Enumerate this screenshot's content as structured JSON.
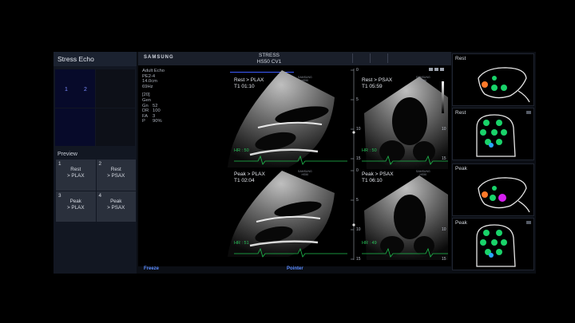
{
  "left_panel": {
    "title": "Stress Echo",
    "layout_cells": [
      "1",
      "2",
      "3",
      "4"
    ],
    "preview_label": "Preview",
    "preview_items": [
      {
        "num": "1",
        "line1": "Rest",
        "line2": "> PLAX"
      },
      {
        "num": "2",
        "line1": "Rest",
        "line2": "> PSAX"
      },
      {
        "num": "3",
        "line1": "Peak",
        "line2": "> PLAX"
      },
      {
        "num": "4",
        "line1": "Peak",
        "line2": "> PSAX"
      }
    ]
  },
  "header": {
    "brand": "SAMSUNG",
    "title_line1": "STRESS",
    "title_line2": "HS50 CV1"
  },
  "params": {
    "mode": "Adult Echo",
    "probe": "PE2-4",
    "depth": "14.0cm",
    "rate": "69Hz",
    "index": "[20]",
    "gen": "Gen",
    "rows": [
      {
        "k": "Gn",
        "v": "52"
      },
      {
        "k": "DR",
        "v": "100"
      },
      {
        "k": "FA",
        "v": "3"
      },
      {
        "k": "P",
        "v": "90%"
      }
    ]
  },
  "views": [
    {
      "label1": "Rest > PLAX",
      "label2": "T1 01:10",
      "hr": "HR : 50"
    },
    {
      "label1": "Rest > PSAX",
      "label2": "T1 05:59",
      "hr": "HR : 50"
    },
    {
      "label1": "Peak > PLAX",
      "label2": "T1 02:04",
      "hr": "HR : 51"
    },
    {
      "label1": "Peak > PSAX",
      "label2": "T1 06:10",
      "hr": "HR : 49"
    }
  ],
  "watermark": {
    "line1": "SAMSUNG",
    "line2": "HS50"
  },
  "scale_ticks": [
    "0",
    "5",
    "10",
    "15"
  ],
  "status": {
    "freeze": "Freeze",
    "pointer": "Pointer"
  },
  "segments": [
    {
      "label": "Rest"
    },
    {
      "label": "Rest"
    },
    {
      "label": "Peak"
    },
    {
      "label": "Peak"
    }
  ],
  "colors": {
    "normal": "#19d36a",
    "abnormal": "#ff7a2a",
    "severe": "#d61ff0",
    "accent": "#3d5cff"
  }
}
